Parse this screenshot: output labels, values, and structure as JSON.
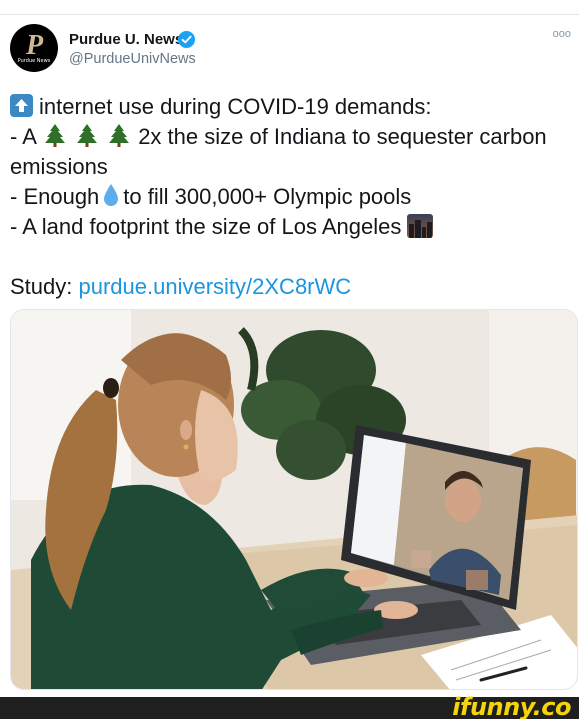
{
  "author": {
    "display_name": "Purdue U. News",
    "handle": "@PurdueUnivNews",
    "avatar_logo": "P",
    "avatar_tagline": "Purdue News",
    "verified": true
  },
  "more_label": "ooo",
  "tweet": {
    "line1": "internet use during COVID-19 demands:",
    "line2_prefix": "- A",
    "line2_suffix": "2x the size of Indiana to sequester carbon",
    "line3": "emissions",
    "line4_prefix": "- Enough",
    "line4_suffix": "to fill 300,000+ Olympic pools",
    "line5": "- A land footprint the size of Los Angeles",
    "study_label": "Study:",
    "study_link": "purdue.university/2XC8rWC"
  },
  "icons": {
    "up_arrow": "up-arrow-icon",
    "tree": "evergreen-tree-icon",
    "droplet": "droplet-icon",
    "city": "city-dusk-icon"
  },
  "photo": {
    "description_icon": "woman-video-call-photo"
  },
  "watermark": "ifunny.co",
  "colors": {
    "link": "#1b95e0",
    "verified": "#1da1f2",
    "watermark": "#f6d40b"
  }
}
